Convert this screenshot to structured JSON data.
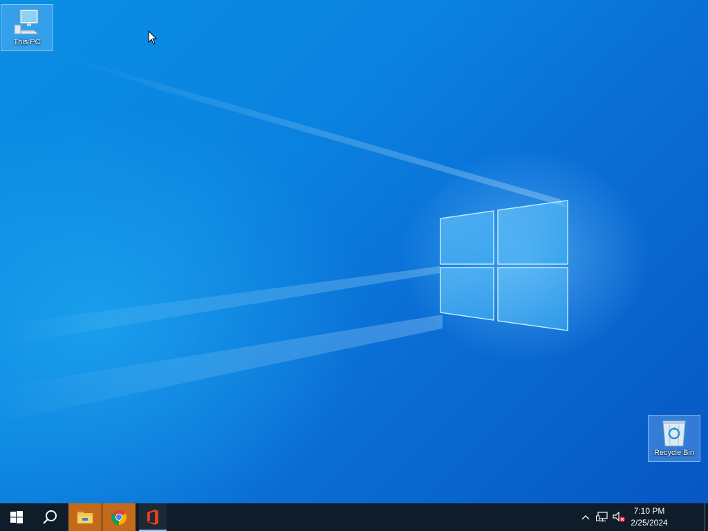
{
  "desktop": {
    "icons": [
      {
        "name": "this-pc",
        "label": "This PC",
        "icon": "computer-icon"
      },
      {
        "name": "recycle-bin",
        "label": "Recycle Bin",
        "icon": "recycle-bin-icon"
      }
    ],
    "wallpaper": "windows-10-blue-logo",
    "colors": {
      "wallpaper_light": "#1aa7f0",
      "wallpaper_dark": "#0757c4",
      "taskbar": "#0f1c2a",
      "active_app_highlight": "#c46a1b"
    }
  },
  "taskbar": {
    "start_icon": "windows-start-icon",
    "search_icon": "search-icon",
    "apps": [
      {
        "name": "file-explorer",
        "icon": "folder-icon",
        "highlighted": true
      },
      {
        "name": "google-chrome",
        "icon": "chrome-icon",
        "highlighted": true
      },
      {
        "name": "microsoft-office",
        "icon": "office-icon",
        "highlighted": false,
        "running": true
      }
    ],
    "tray": {
      "icons": [
        "chevron-up-icon",
        "network-icon",
        "volume-muted-icon"
      ],
      "time": "7:10 PM",
      "date": "2/25/2024"
    }
  }
}
